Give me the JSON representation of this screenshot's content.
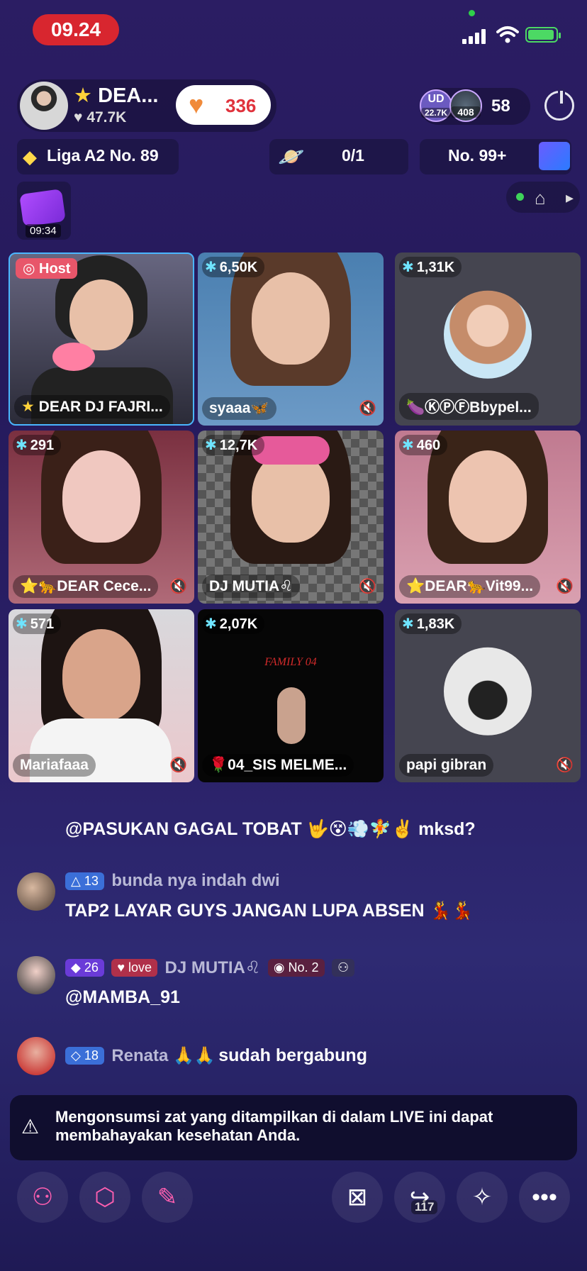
{
  "status_bar": {
    "time": "09.24"
  },
  "host": {
    "name": "DEA...",
    "likes": "47.7K",
    "follow_count": "336"
  },
  "viewers": {
    "avatar1_label": "UD",
    "avatar1_sub": "22.7K",
    "avatar2_sub": "408",
    "count": "58"
  },
  "league": {
    "label": "Liga A2 No. 89"
  },
  "planet": {
    "label": "0/1"
  },
  "rank": {
    "label": "No. 99+"
  },
  "gift": {
    "timer": "09:34"
  },
  "host_badge": "Host",
  "tiles": [
    {
      "score": "",
      "name": "DEAR DJ FAJRI...",
      "is_host": true
    },
    {
      "score": "6,50K",
      "name": "syaaa🦋"
    },
    {
      "score": "1,31K",
      "name": "🍆ⓀⓅⒻBbypel..."
    },
    {
      "score": "291",
      "name": "⭐🐆DEAR Cece..."
    },
    {
      "score": "12,7K",
      "name": "DJ MUTIA♌"
    },
    {
      "score": "460",
      "name": "⭐DEAR🐆Vit99..."
    },
    {
      "score": "571",
      "name": "Mariafaaa"
    },
    {
      "score": "2,07K",
      "name": "🌹04_SIS MELME..."
    },
    {
      "score": "1,83K",
      "name": "papi gibran"
    }
  ],
  "tile_overlay_text": "FAMILY 04",
  "chat": [
    {
      "message": "@PASUKAN GAGAL TOBAT 🤟😵💨🧚✌️ mksd?"
    },
    {
      "level": "13",
      "user": "bunda nya indah dwi",
      "message": "TAP2 LAYAR GUYS JANGAN LUPA ABSEN 💃💃"
    },
    {
      "level": "26",
      "fan_badge": "love",
      "user": "DJ MUTIA♌",
      "rank_badge": "No. 2",
      "message": "@MAMBA_91"
    },
    {
      "level": "18",
      "user": "Renata 🙏🙏",
      "message": "sudah bergabung"
    }
  ],
  "warning": {
    "text": "Mengonsumsi zat yang ditampilkan di dalam LIVE ini dapat membahayakan kesehatan Anda."
  },
  "bottom_bar": {
    "share_count": "117"
  },
  "colors": {
    "accent_red": "#d8262f",
    "host_pink": "#e8566a",
    "gem_cyan": "#6fe4ff"
  }
}
